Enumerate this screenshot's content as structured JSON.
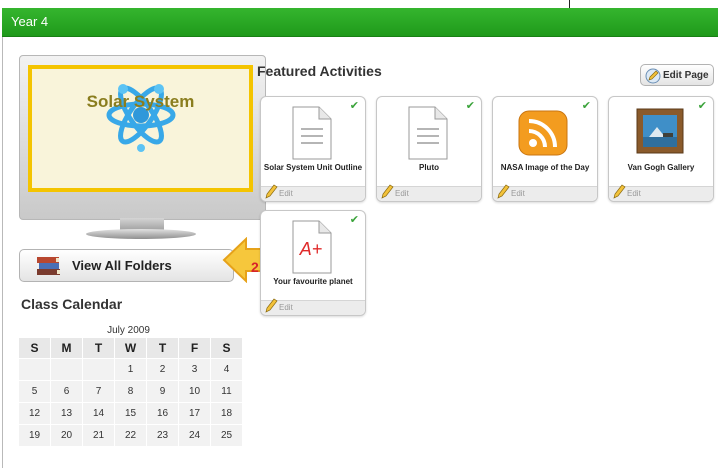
{
  "window": {
    "title": "Year 4"
  },
  "course_banner": {
    "title": "Solar System",
    "icon": "atom-icon"
  },
  "sidebar": {
    "view_folders_label": "View All Folders",
    "callout_number": "2",
    "calendar_heading": "Class Calendar",
    "calendar": {
      "month": "July 2009",
      "weekdays": [
        "S",
        "M",
        "T",
        "W",
        "T",
        "F",
        "S"
      ],
      "weeks": [
        [
          "",
          "",
          "",
          "1",
          "2",
          "3",
          "4"
        ],
        [
          "5",
          "6",
          "7",
          "8",
          "9",
          "10",
          "11"
        ],
        [
          "12",
          "13",
          "14",
          "15",
          "16",
          "17",
          "18"
        ],
        [
          "19",
          "20",
          "21",
          "22",
          "23",
          "24",
          "25"
        ]
      ]
    }
  },
  "featured": {
    "heading": "Featured Activities",
    "edit_page_label": "Edit Page",
    "cards": [
      {
        "title": "Solar System Unit Outline",
        "edit": "Edit",
        "icon": "document-icon"
      },
      {
        "title": "Pluto",
        "edit": "Edit",
        "icon": "document-icon"
      },
      {
        "title": "NASA Image of the Day",
        "edit": "Edit",
        "icon": "rss-feed-icon"
      },
      {
        "title": "Van Gogh Gallery",
        "edit": "Edit",
        "icon": "framed-picture-icon"
      },
      {
        "title": "Your favourite planet",
        "edit": "Edit",
        "icon": "graded-paper-icon",
        "grade": "A+"
      }
    ]
  },
  "colors": {
    "titlebar": "#1f9a1b",
    "screen_border": "#f4c400",
    "callout": "#f6c73c"
  }
}
